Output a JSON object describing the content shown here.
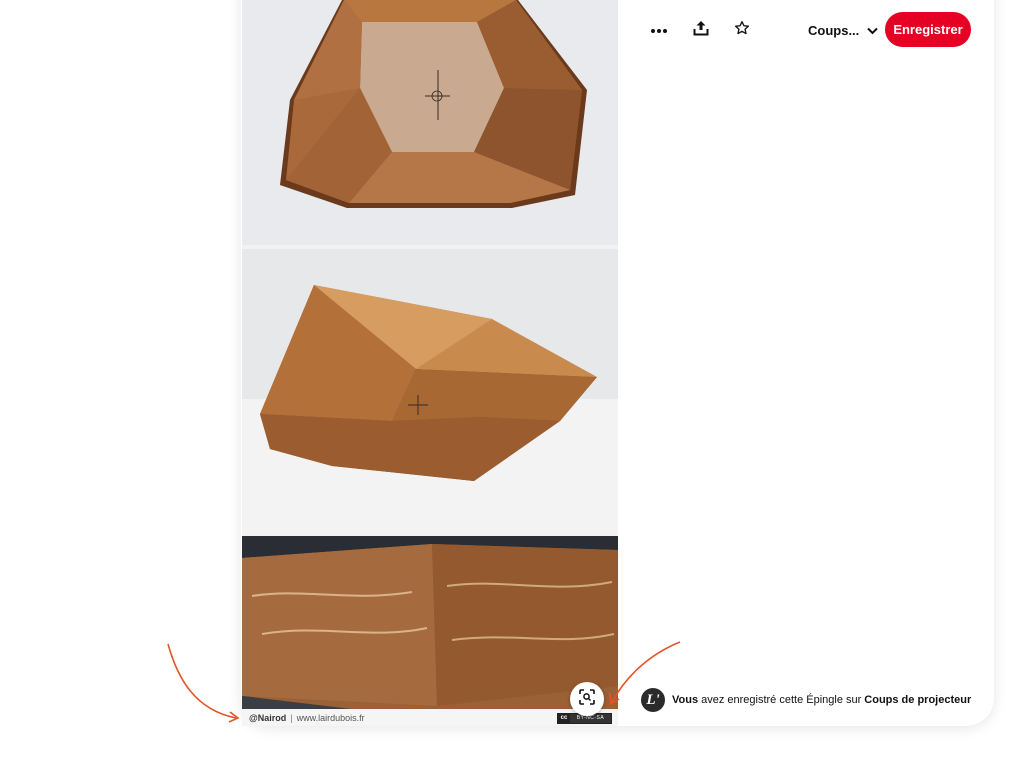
{
  "toolbar": {
    "more_icon": "ellipsis-icon",
    "share_icon": "share-upload-icon",
    "favorite_icon": "star-outline-icon",
    "board_label": "Coups...",
    "save_label": "Enregistrer"
  },
  "pin_image": {
    "credit_handle": "@Nairod",
    "credit_separator": "|",
    "credit_site": "www.lairdubois.fr",
    "license_cc": "cc",
    "license_text": "BY-NC-SA"
  },
  "visual_search_icon": "lens-search-icon",
  "saved_note": {
    "avatar_letter": "L'",
    "subject": "Vous",
    "text": "avez enregistré cette Épingle sur",
    "board": "Coups de projecteur"
  },
  "colors": {
    "save_button": "#e60023",
    "annotation_arrow": "#e2552b",
    "wood": "#a5683a"
  }
}
